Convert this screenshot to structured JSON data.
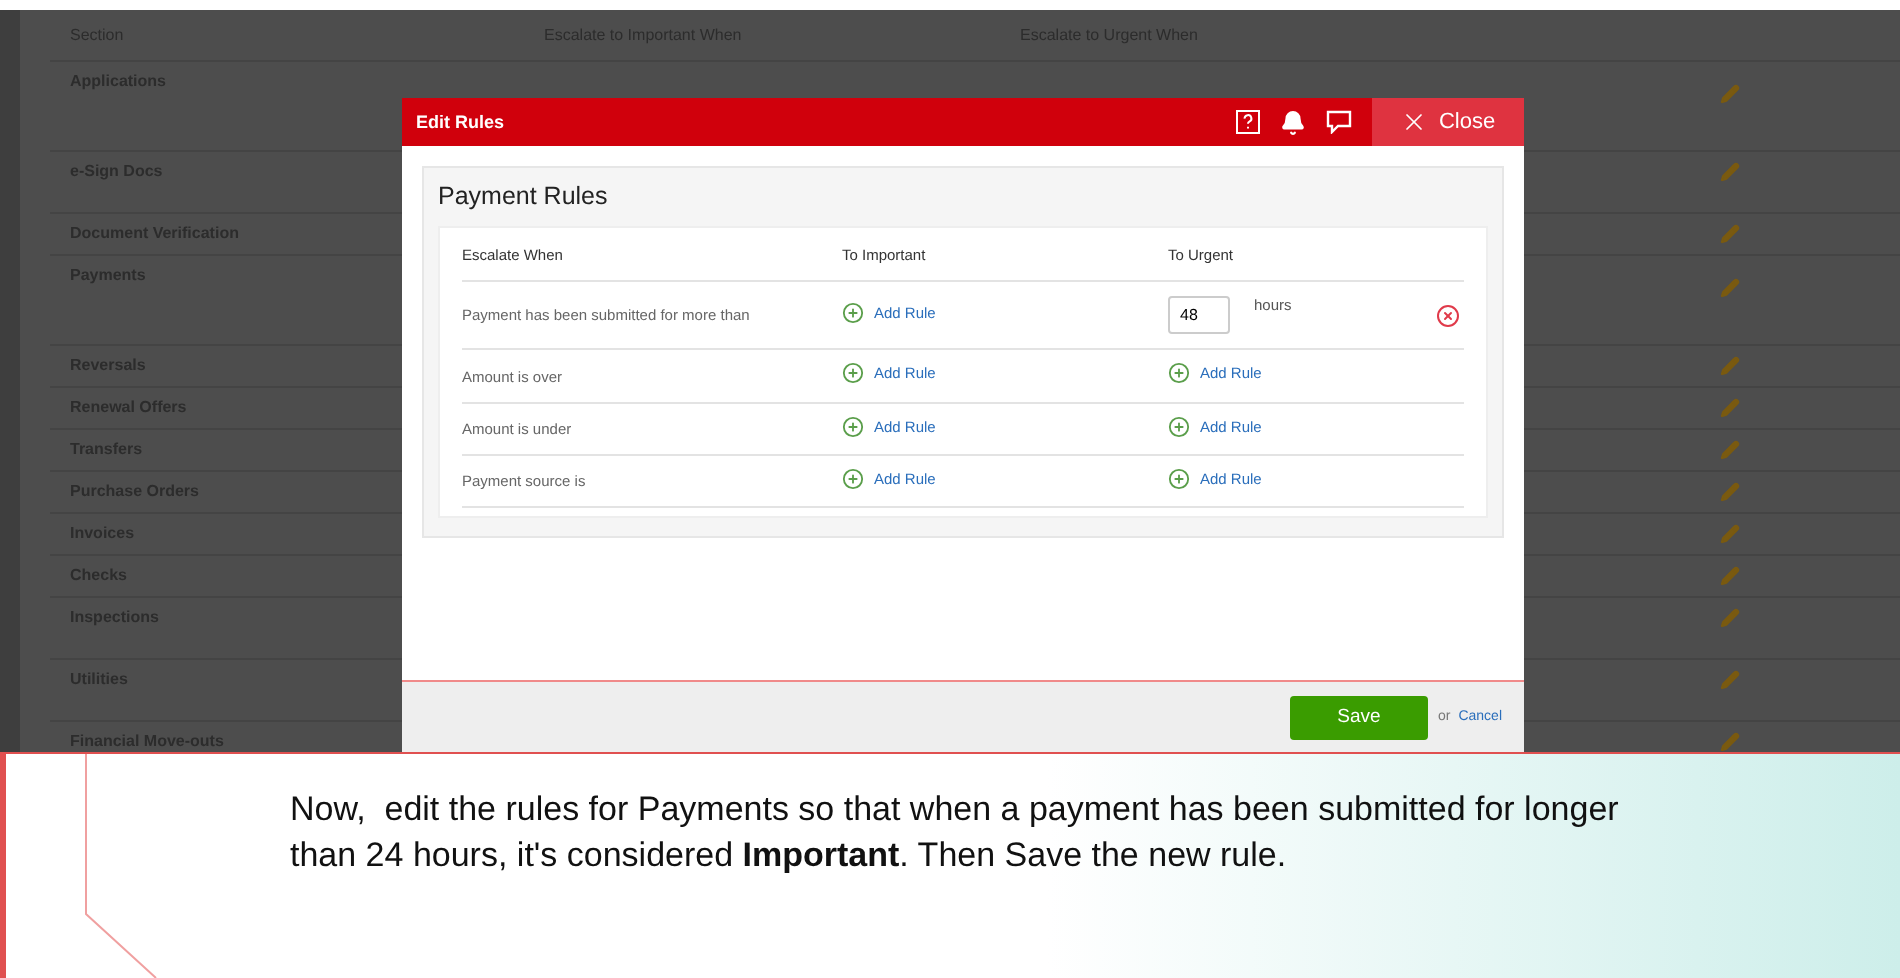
{
  "background_table": {
    "columns": [
      "Section",
      "Escalate to Important When",
      "Escalate to Urgent When"
    ],
    "rows": [
      {
        "section": "Applications",
        "kind": "tall"
      },
      {
        "section": "e-Sign Docs",
        "kind": "medium"
      },
      {
        "section": "Document Verification",
        "kind": "short"
      },
      {
        "section": "Payments",
        "kind": "tall"
      },
      {
        "section": "Reversals",
        "kind": "short"
      },
      {
        "section": "Renewal Offers",
        "kind": "short"
      },
      {
        "section": "Transfers",
        "kind": "short"
      },
      {
        "section": "Purchase Orders",
        "kind": "short"
      },
      {
        "section": "Invoices",
        "kind": "short"
      },
      {
        "section": "Checks",
        "kind": "short"
      },
      {
        "section": "Inspections",
        "kind": "medium"
      },
      {
        "section": "Utilities",
        "kind": "medium"
      },
      {
        "section": "Financial Move-outs",
        "kind": "short"
      }
    ]
  },
  "modal": {
    "title": "Edit Rules",
    "close": "Close",
    "panel_title": "Payment Rules",
    "columns": [
      "Escalate When",
      "To Important",
      "To Urgent"
    ],
    "rows": [
      {
        "condition": "Payment has been submitted for more than",
        "important": {
          "kind": "add",
          "label": "Add Rule"
        },
        "urgent": {
          "kind": "input",
          "value": "48",
          "unit": "hours"
        },
        "removable": true
      },
      {
        "condition": "Amount is over",
        "important": {
          "kind": "add",
          "label": "Add Rule"
        },
        "urgent": {
          "kind": "add",
          "label": "Add Rule"
        },
        "removable": false
      },
      {
        "condition": "Amount is under",
        "important": {
          "kind": "add",
          "label": "Add Rule"
        },
        "urgent": {
          "kind": "add",
          "label": "Add Rule"
        },
        "removable": false
      },
      {
        "condition": "Payment source is",
        "important": {
          "kind": "add",
          "label": "Add Rule"
        },
        "urgent": {
          "kind": "add",
          "label": "Add Rule"
        },
        "removable": false
      }
    ],
    "footer": {
      "save": "Save",
      "or": "or",
      "cancel": "Cancel"
    }
  },
  "callout": {
    "text": "Now,  edit the rules for Payments so that when a payment has been submitted for longer than 24 hours, it's considered **Important**. Then Save the new rule."
  }
}
